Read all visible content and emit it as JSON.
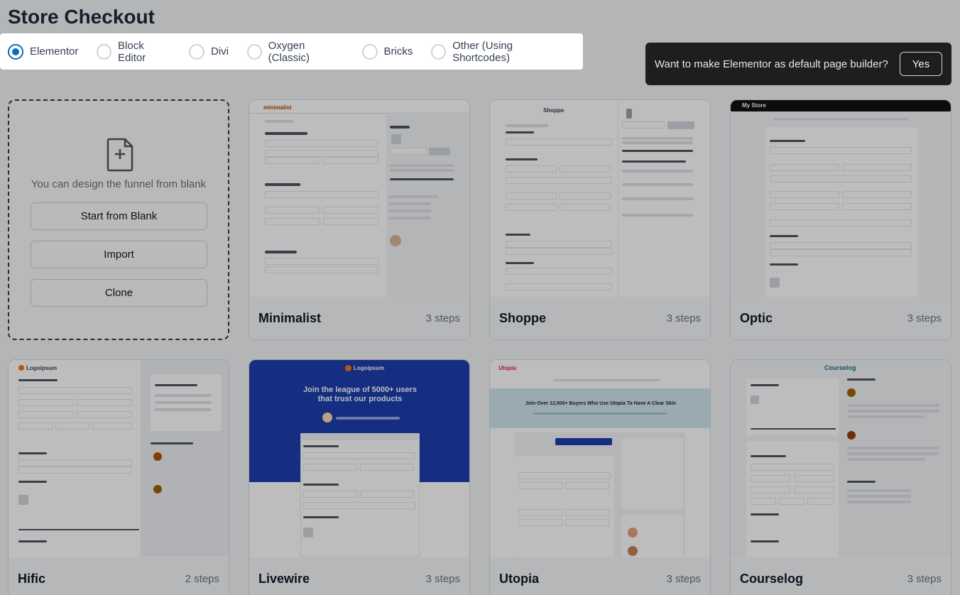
{
  "page": {
    "title": "Store Checkout"
  },
  "builders": {
    "selected": "Elementor",
    "options": [
      "Elementor",
      "Block Editor",
      "Divi",
      "Oxygen (Classic)",
      "Bricks",
      "Other (Using Shortcodes)"
    ]
  },
  "notice": {
    "text": "Want to make Elementor as default page builder?",
    "button": "Yes"
  },
  "blank": {
    "text": "You can design the funnel from blank",
    "buttons": [
      "Start from Blank",
      "Import",
      "Clone"
    ]
  },
  "templates": [
    {
      "name": "Minimalist",
      "steps": "3 steps",
      "logo": "minimalist"
    },
    {
      "name": "Shoppe",
      "steps": "3 steps",
      "logo": "Shoppe"
    },
    {
      "name": "Optic",
      "steps": "3 steps",
      "logo": "My Store"
    },
    {
      "name": "Hific",
      "steps": "2 steps",
      "logo": "Logoipsum"
    },
    {
      "name": "Livewire",
      "steps": "3 steps",
      "logo": "Logoipsum",
      "headline": "Join the league of 5000+ users that trust our products"
    },
    {
      "name": "Utopia",
      "steps": "3 steps",
      "logo": "Utopia",
      "headline": "Join Over 12,000+ Buyers Who Use Utopia To Have A Clear Skin"
    },
    {
      "name": "Courselog",
      "steps": "3 steps",
      "logo": "Courselog"
    }
  ],
  "colors": {
    "accent": "#0b6cb8",
    "livewire_blue": "#1d3fb0",
    "utopia_teal": "#cfe6ef"
  }
}
